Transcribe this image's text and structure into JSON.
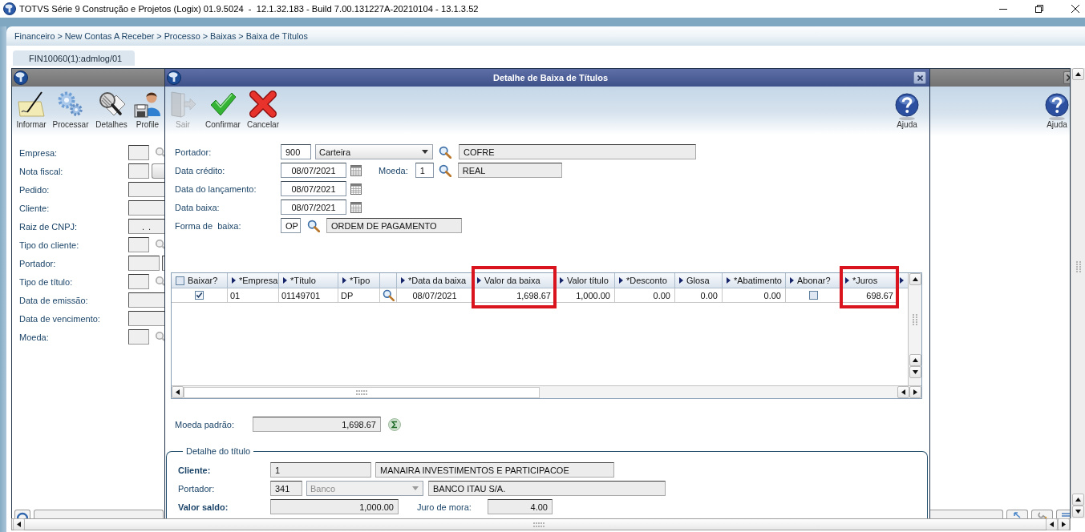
{
  "app_window": {
    "title": "TOTVS Série 9 Construção e Projetos (Logix) 01.9.5024  -  12.1.32.183 - Build 7.00.131227A-20210104 - 13.1.3.52"
  },
  "breadcrumb": "Financeiro > New Contas A Receber > Processo > Baixas > Baixa de Títulos",
  "tabs": [
    {
      "label": "FIN10060(1):admlog/01",
      "selected": true
    }
  ],
  "main_window": {
    "toolbar": [
      {
        "label": "Informar",
        "kind": "note"
      },
      {
        "label": "Processar",
        "kind": "gears"
      },
      {
        "label": "Detalhes",
        "kind": "inspect"
      },
      {
        "label": "Profile",
        "kind": "profile"
      }
    ],
    "help": {
      "label": "Ajuda"
    },
    "filters": [
      {
        "label": "Empresa:",
        "kind": "lookup"
      },
      {
        "label": "Nota fiscal:",
        "kind": "button"
      },
      {
        "label": "Pedido:",
        "kind": "wide"
      },
      {
        "label": "Cliente:",
        "kind": "wide"
      },
      {
        "label": "Raiz de CNPJ:",
        "kind": "wide",
        "value": ". ."
      },
      {
        "label": "Tipo do cliente:",
        "kind": "lookup"
      },
      {
        "label": "Portador:",
        "kind": "pair"
      },
      {
        "label": "Tipo de título:",
        "kind": "lookup"
      },
      {
        "label": "Data de emissão:",
        "kind": "wide"
      },
      {
        "label": "Data de vencimento:",
        "kind": "wide"
      },
      {
        "label": "Moeda:",
        "kind": "lookup"
      }
    ]
  },
  "dialog": {
    "title": "Detalhe de Baixa de Títulos",
    "toolbar": [
      {
        "label": "Sair",
        "kind": "exit",
        "disabled": true
      },
      {
        "label": "Confirmar",
        "kind": "confirm",
        "disabled": false
      },
      {
        "label": "Cancelar",
        "kind": "cancel",
        "disabled": false
      }
    ],
    "help": {
      "label": "Ajuda"
    },
    "portador": {
      "label": "Portador:",
      "code": "900",
      "type": {
        "value": "Carteira",
        "disabled": false
      },
      "name": "COFRE"
    },
    "data_credito": {
      "label": "Data crédito:",
      "value": "08/07/2021"
    },
    "moeda": {
      "label": "Moeda:",
      "code": "1",
      "name": "REAL"
    },
    "data_lancamento": {
      "label": "Data do lançamento:",
      "value": "08/07/2021"
    },
    "data_baixa": {
      "label": "Data baixa:",
      "value": "08/07/2021"
    },
    "forma_baixa": {
      "label": "Forma de  baixa:",
      "code": "OP",
      "name": "ORDEM DE PAGAMENTO"
    },
    "grid": {
      "select_all": {
        "checked": false
      },
      "columns": [
        {
          "label": "Baixar?",
          "kind": "select",
          "highlighted": false
        },
        {
          "label": "*Empresa",
          "kind": "text",
          "highlighted": false
        },
        {
          "label": "*Título",
          "kind": "text",
          "highlighted": false
        },
        {
          "label": "*Tipo",
          "kind": "lookup",
          "highlighted": false
        },
        {
          "label": "*Data da baixa",
          "kind": "date",
          "highlighted": false
        },
        {
          "label": "Valor da baixa",
          "kind": "number",
          "highlighted": true
        },
        {
          "label": "Valor título",
          "kind": "number",
          "highlighted": false
        },
        {
          "label": "*Desconto",
          "kind": "number",
          "highlighted": false
        },
        {
          "label": "Glosa",
          "kind": "number",
          "highlighted": false
        },
        {
          "label": "*Abatimento",
          "kind": "number",
          "highlighted": false
        },
        {
          "label": "Abonar?",
          "kind": "check",
          "highlighted": false
        },
        {
          "label": "*Juros",
          "kind": "number",
          "highlighted": true
        }
      ],
      "rows": [
        {
          "cells": [
            {
              "checked": true
            },
            "01",
            "01149701",
            "DP",
            "08/07/2021",
            "1,698.67",
            "1,000.00",
            "0.00",
            "0.00",
            "0.00",
            {
              "checked": false
            },
            "698.67"
          ]
        }
      ]
    },
    "moeda_padrao": {
      "label": "Moeda padrão:",
      "value": "1,698.67"
    },
    "detail": {
      "legend": "Detalhe do título",
      "cliente": {
        "label": "Cliente:",
        "required": true,
        "code": "1",
        "name": "MANAIRA INVESTIMENTOS E PARTICIPACOE"
      },
      "portador": {
        "label": "Portador:",
        "required": false,
        "code": "341",
        "type": {
          "value": "Banco",
          "disabled": true
        },
        "name": "BANCO ITAU S/A."
      },
      "valor_saldo": {
        "label": "Valor saldo:",
        "required": true,
        "value": "1,000.00"
      },
      "juro_mora": {
        "label": "Juro de mora:",
        "required": false,
        "value": "4.00"
      }
    }
  }
}
